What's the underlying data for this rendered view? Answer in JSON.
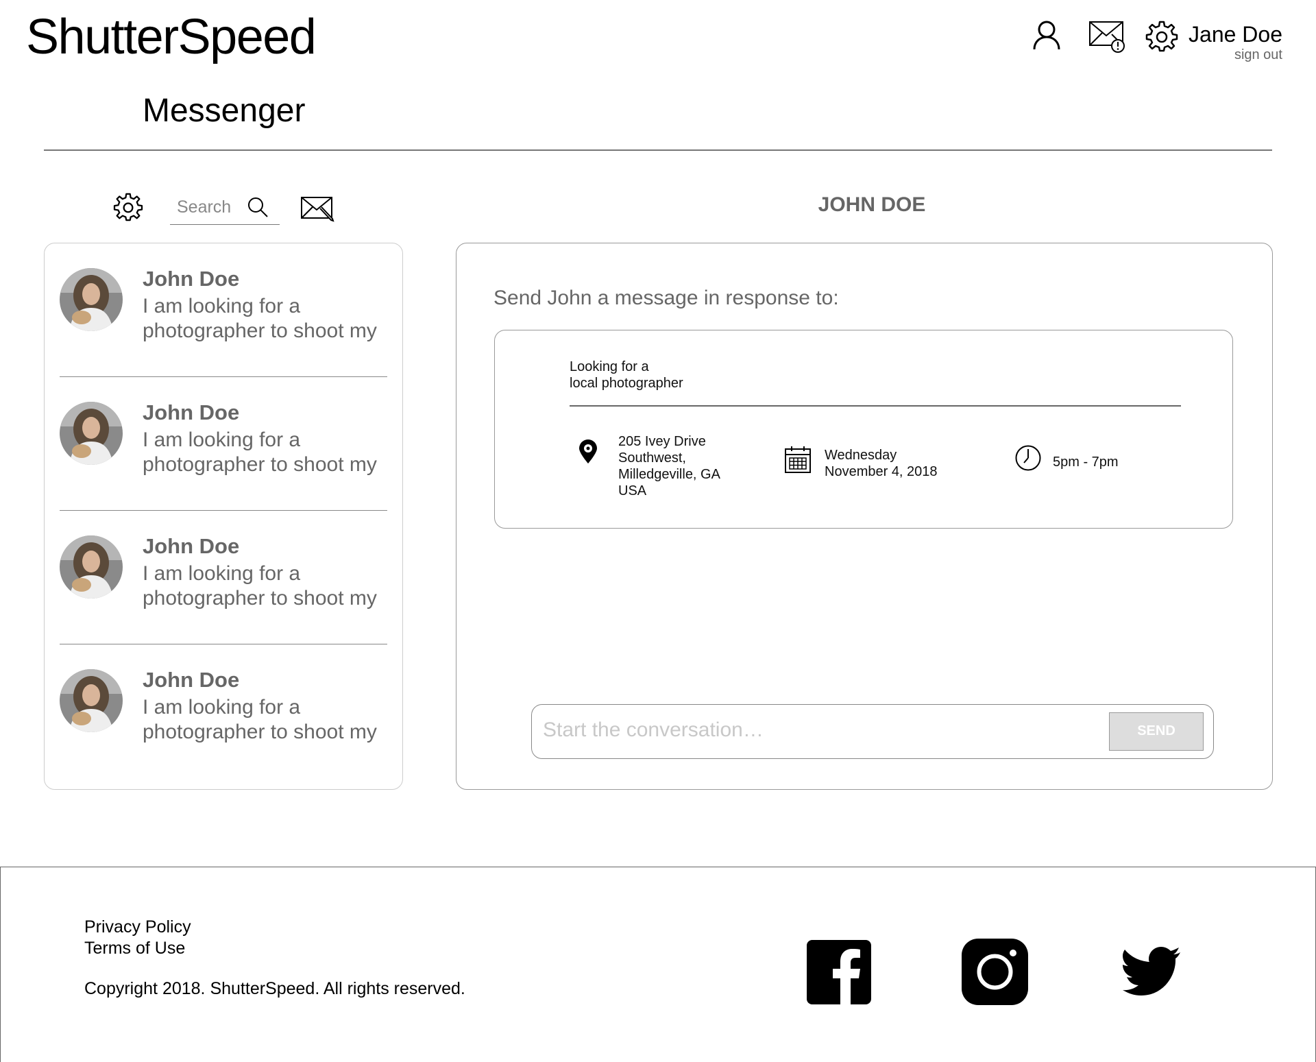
{
  "header": {
    "logo": "ShutterSpeed",
    "user_name": "Jane Doe",
    "sign_out": "sign out",
    "icons": [
      "user-icon",
      "mail-alert-icon",
      "gear-icon"
    ]
  },
  "page": {
    "title": "Messenger"
  },
  "sidebar": {
    "search_placeholder": "Search",
    "icons": [
      "gear-icon",
      "search-icon",
      "compose-mail-icon"
    ],
    "conversations": [
      {
        "name": "John Doe",
        "preview": "I am looking for a photographer to shoot my"
      },
      {
        "name": "John Doe",
        "preview": "I am looking for a photographer to shoot my"
      },
      {
        "name": "John Doe",
        "preview": "I am looking for a photographer to shoot my"
      },
      {
        "name": "John Doe",
        "preview": "I am looking for a photographer to shoot my"
      }
    ]
  },
  "chat": {
    "header": "JOHN DOE",
    "respond_label": "Send John a message in response to:",
    "job": {
      "title_line1": "Looking for a",
      "title_line2": "local photographer",
      "address": [
        "205 Ivey Drive",
        "Southwest,",
        "Milledgeville, GA",
        "USA"
      ],
      "date_line1": "Wednesday",
      "date_line2": "November 4, 2018",
      "time": "5pm - 7pm"
    },
    "compose_placeholder": "Start the conversation…",
    "send_label": "SEND"
  },
  "footer": {
    "privacy": "Privacy Policy",
    "terms": "Terms of Use",
    "copyright": "Copyright 2018. ShutterSpeed. All rights reserved.",
    "social_icons": [
      "facebook-icon",
      "instagram-icon",
      "twitter-icon"
    ]
  }
}
